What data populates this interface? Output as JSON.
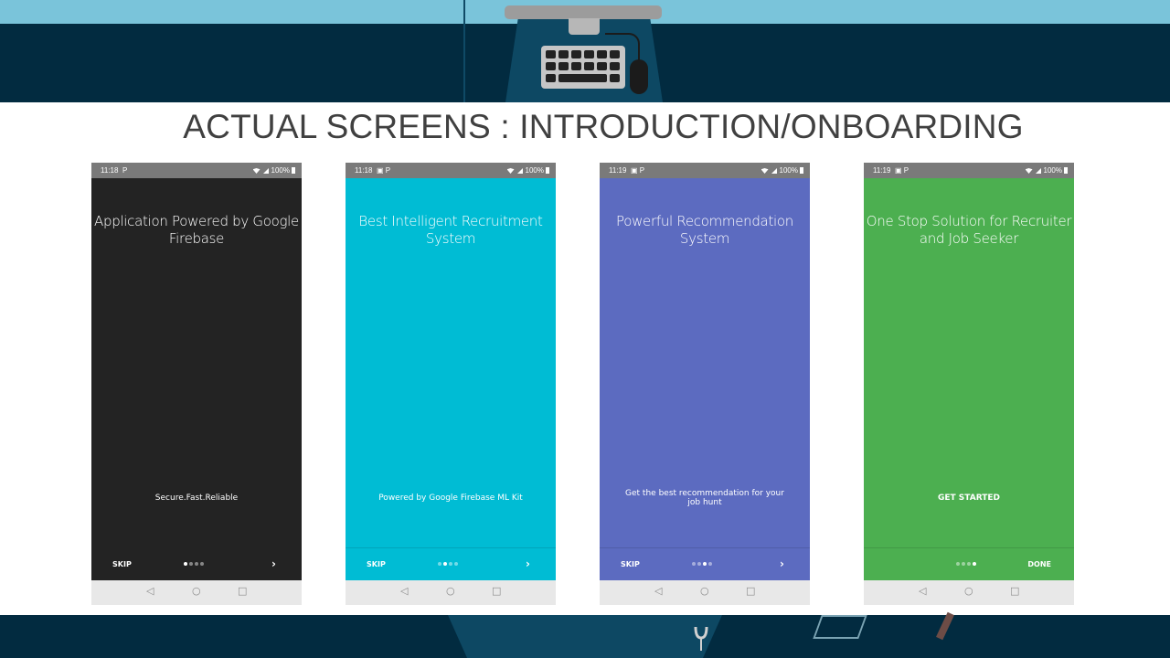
{
  "slide": {
    "title": "ACTUAL SCREENS : INTRODUCTION/ONBOARDING"
  },
  "colors": {
    "screen1": "#232323",
    "screen2": "#00bcd4",
    "screen3": "#5c6bc0",
    "screen4": "#4caf50",
    "header_band": "#022b40",
    "header_sky": "#7ac4da"
  },
  "phones": [
    {
      "status": {
        "time": "11:18",
        "left_icons": "P",
        "battery": "100%"
      },
      "heading": "Application Powered by Google Firebase",
      "description": "Secure.Fast.Reliable",
      "skip_label": "SKIP",
      "next_label": "›",
      "active_dot": 1
    },
    {
      "status": {
        "time": "11:18",
        "left_icons": "▣ P",
        "battery": "100%"
      },
      "heading": "Best Intelligent Recruitment System",
      "description": "Powered by Google Firebase ML Kit",
      "skip_label": "SKIP",
      "next_label": "›",
      "active_dot": 2
    },
    {
      "status": {
        "time": "11:19",
        "left_icons": "▣ P",
        "battery": "100%"
      },
      "heading": "Powerful Recommendation System",
      "description": "Get the best recommendation for your job hunt",
      "skip_label": "SKIP",
      "next_label": "›",
      "active_dot": 3
    },
    {
      "status": {
        "time": "11:19",
        "left_icons": "▣ P",
        "battery": "100%"
      },
      "heading": "One Stop Solution for Recruiter and Job Seeker",
      "description": "GET STARTED",
      "done_label": "DONE",
      "active_dot": 4
    }
  ],
  "android_nav": {
    "back": "◁",
    "home": "○",
    "recents": "□"
  }
}
